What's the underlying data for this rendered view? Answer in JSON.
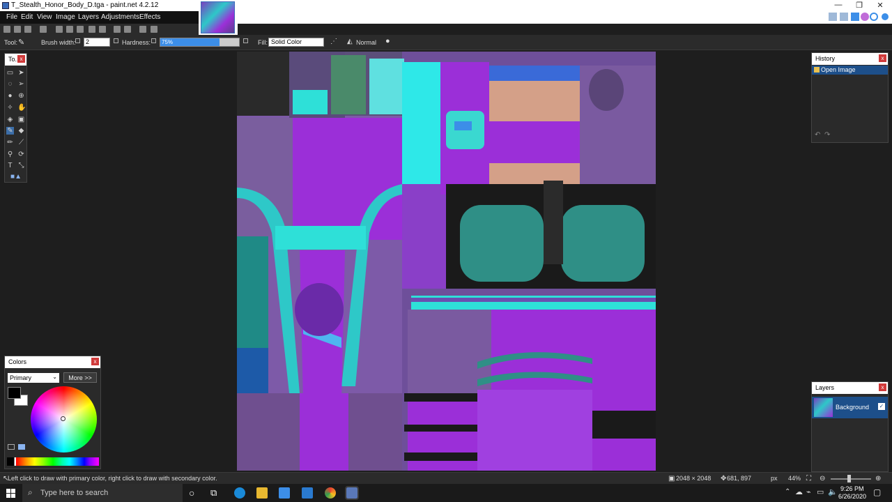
{
  "window": {
    "title": "T_Stealth_Honor_Body_D.tga - paint.net 4.2.12",
    "minimize": "—",
    "maximize": "❐",
    "close": "✕"
  },
  "menu": [
    "File",
    "Edit",
    "View",
    "Image",
    "Layers",
    "Adjustments",
    "Effects"
  ],
  "toolbar": {
    "tool_label": "Tool:",
    "brush_width_label": "Brush width:",
    "brush_width_value": "2",
    "hardness_label": "Hardness:",
    "hardness_value": "75%",
    "hardness_level": 0.75,
    "fill_label": "Fill:",
    "fill_value": "Solid Color",
    "blend_mode": "Normal"
  },
  "tools_panel": {
    "title": "To..."
  },
  "colors_panel": {
    "title": "Colors",
    "mode": "Primary",
    "more_button": "More >>",
    "primary_color": "#000000",
    "secondary_color": "#ffffff"
  },
  "history_panel": {
    "title": "History",
    "items": [
      "Open Image"
    ]
  },
  "layers_panel": {
    "title": "Layers",
    "items": [
      "Background"
    ]
  },
  "status": {
    "hint": "Left click to draw with primary color, right click to draw with secondary color.",
    "image_size": "2048 × 2048",
    "cursor_pos": "681, 897",
    "units": "px",
    "zoom": "44%"
  },
  "taskbar": {
    "search_placeholder": "Type here to search",
    "time": "9:26 PM",
    "date": "6/26/2020"
  },
  "colors": {
    "accent": "#3c8ee8",
    "texture_purple": "#9b2fd8",
    "texture_cyan": "#2ee0d8",
    "texture_teal": "#2f8f86"
  }
}
